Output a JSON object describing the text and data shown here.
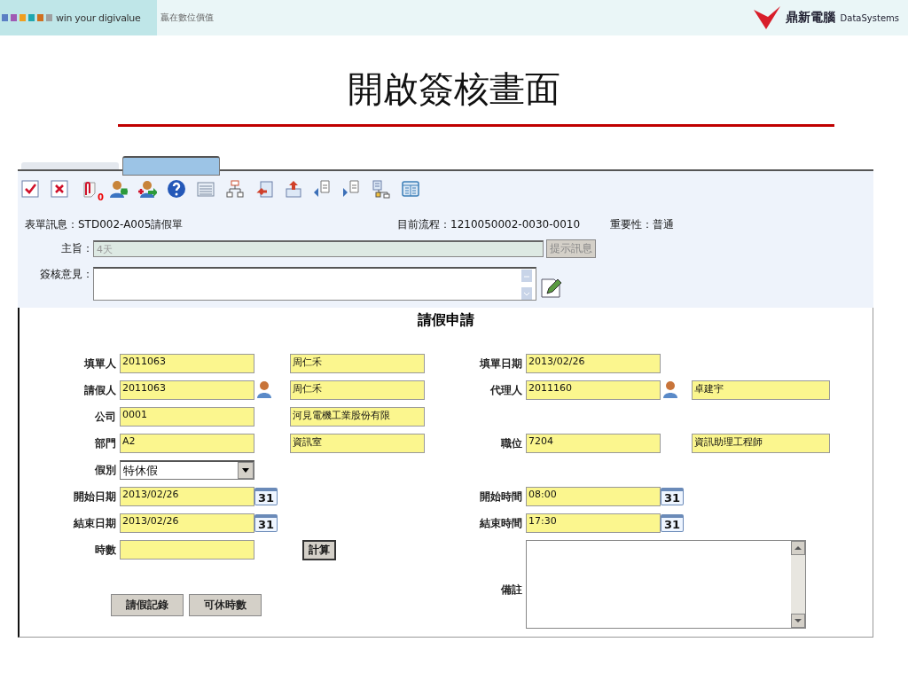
{
  "header": {
    "tagline": "win your digivalue",
    "tagline_cjk": "贏在數位價值",
    "brand_cjk": "鼎新電腦",
    "brand_en": "DataSystems"
  },
  "slide_title": "開啟簽核畫面",
  "toolbar": {
    "attachment_count": "0"
  },
  "info": {
    "form_label": "表單訊息：",
    "form_value": "STD002-A005請假單",
    "flow_label": "目前流程：",
    "flow_value": "1210050002-0030-0010",
    "priority_label": "重要性：",
    "priority_value": "普通",
    "subject_label": "主旨：",
    "subject_value": "4天",
    "subject_disabled": true,
    "hint_button": "提示訊息",
    "hint_disabled": true,
    "comment_label": "簽核意見："
  },
  "form": {
    "title": "請假申請",
    "rows": [
      {
        "left": {
          "label": "填單人",
          "value": "2011063",
          "second": "周仁禾"
        },
        "right": {
          "label": "填單日期",
          "value": "2013/02/26"
        }
      },
      {
        "left": {
          "label": "請假人",
          "value": "2011063",
          "picker": {
            "kind": "person"
          },
          "second": "周仁禾"
        },
        "right": {
          "label": "代理人",
          "value": "2011160",
          "picker": {
            "kind": "person"
          },
          "second": "卓建宇"
        }
      },
      {
        "left": {
          "label": "公司",
          "value": "0001",
          "second": "河見電機工業股份有限"
        }
      },
      {
        "left": {
          "label": "部門",
          "value": "A2",
          "second": "資訊室"
        },
        "right": {
          "label": "職位",
          "value": "7204",
          "second": "資訊助理工程師"
        }
      },
      {
        "left": {
          "label": "假別",
          "kind": "select",
          "value": "特休假"
        }
      },
      {
        "left": {
          "label": "開始日期",
          "value": "2013/02/26",
          "picker": {
            "kind": "calendar",
            "text": "31"
          }
        },
        "right": {
          "label": "開始時間",
          "value": "08:00",
          "picker": {
            "kind": "calendar",
            "text": "31"
          }
        }
      },
      {
        "left": {
          "label": "結束日期",
          "value": "2013/02/26",
          "picker": {
            "kind": "calendar",
            "text": "31"
          }
        },
        "right": {
          "label": "結束時間",
          "value": "17:30",
          "picker": {
            "kind": "calendar",
            "text": "31"
          }
        }
      },
      {
        "left": {
          "label": "時數",
          "action": "計算"
        }
      }
    ],
    "remarks_label": "備註",
    "buttons": [
      "請假記錄",
      "可休時數"
    ]
  }
}
